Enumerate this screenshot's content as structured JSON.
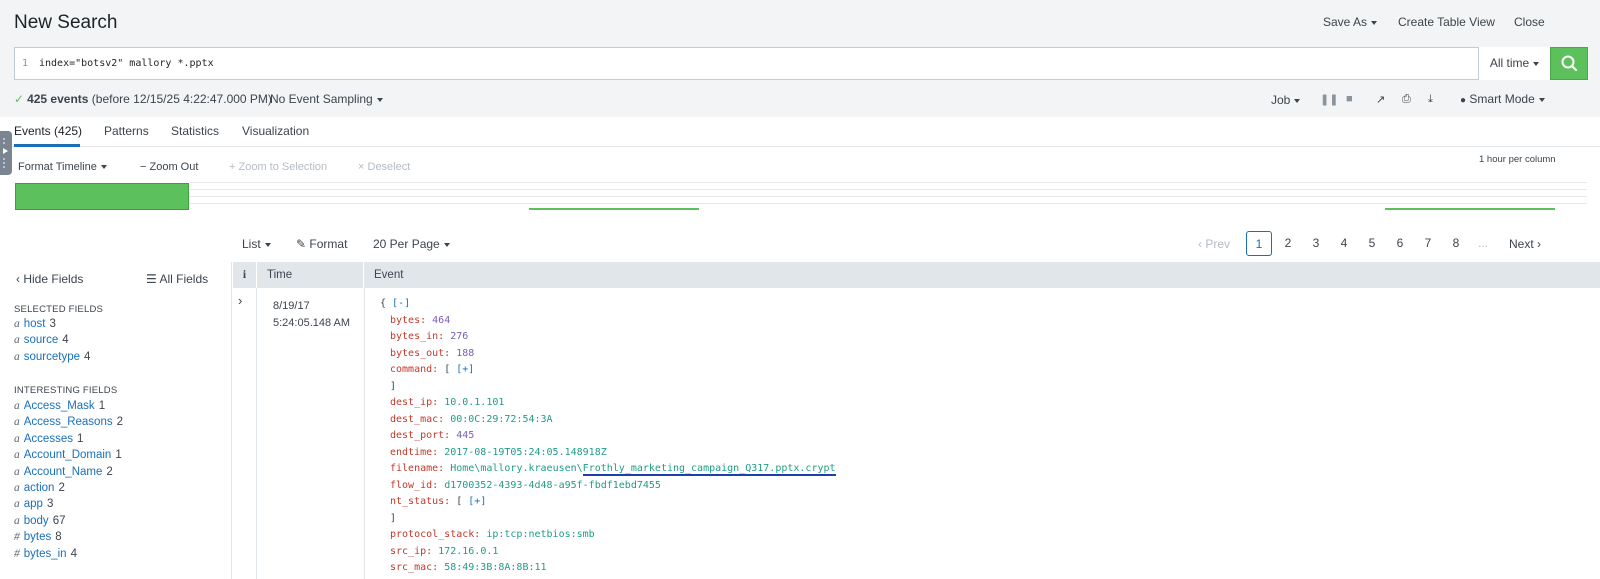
{
  "header": {
    "title": "New Search",
    "save_as": "Save As",
    "create_table_view": "Create Table View",
    "close": "Close"
  },
  "search": {
    "line_number": "1",
    "query": "index=\"botsv2\" mallory *.pptx",
    "time_range": "All time"
  },
  "status": {
    "count": "425 events",
    "detail": "(before 12/15/25 4:22:47.000 PM)",
    "sampling": "No Event Sampling",
    "job": "Job",
    "mode": "Smart Mode"
  },
  "tabs": [
    {
      "label": "Events (425)"
    },
    {
      "label": "Patterns"
    },
    {
      "label": "Statistics"
    },
    {
      "label": "Visualization"
    }
  ],
  "timeline": {
    "format": "Format Timeline",
    "zoom_out": "Zoom Out",
    "zoom_selection": "Zoom to Selection",
    "deselect": "Deselect",
    "scale": "1 hour per column"
  },
  "results_toolbar": {
    "list": "List",
    "format": "Format",
    "per_page": "20 Per Page"
  },
  "pagination": {
    "prev": "Prev",
    "pages": [
      "1",
      "2",
      "3",
      "4",
      "5",
      "6",
      "7",
      "8"
    ],
    "ellipsis": "...",
    "next": "Next"
  },
  "fields": {
    "hide": "Hide Fields",
    "all": "All Fields",
    "selected_title": "SELECTED FIELDS",
    "selected": [
      {
        "type": "a",
        "name": "host",
        "count": "3"
      },
      {
        "type": "a",
        "name": "source",
        "count": "4"
      },
      {
        "type": "a",
        "name": "sourcetype",
        "count": "4"
      }
    ],
    "interesting_title": "INTERESTING FIELDS",
    "interesting": [
      {
        "type": "a",
        "name": "Access_Mask",
        "count": "1"
      },
      {
        "type": "a",
        "name": "Access_Reasons",
        "count": "2"
      },
      {
        "type": "a",
        "name": "Accesses",
        "count": "1"
      },
      {
        "type": "a",
        "name": "Account_Domain",
        "count": "1"
      },
      {
        "type": "a",
        "name": "Account_Name",
        "count": "2"
      },
      {
        "type": "a",
        "name": "action",
        "count": "2"
      },
      {
        "type": "a",
        "name": "app",
        "count": "3"
      },
      {
        "type": "a",
        "name": "body",
        "count": "67"
      },
      {
        "type": "#",
        "name": "bytes",
        "count": "8"
      },
      {
        "type": "#",
        "name": "bytes_in",
        "count": "4"
      }
    ]
  },
  "table": {
    "col_info": "i",
    "col_time": "Time",
    "col_event": "Event"
  },
  "event": {
    "date": "8/19/17",
    "time": "5:24:05.148 AM",
    "open": "{",
    "collapse": "[-]",
    "expand": "[+]",
    "close_bracket": "]",
    "lines": [
      {
        "key": "bytes",
        "value": "464",
        "kind": "num"
      },
      {
        "key": "bytes_in",
        "value": "276",
        "kind": "num"
      },
      {
        "key": "bytes_out",
        "value": "188",
        "kind": "num"
      },
      {
        "key": "command",
        "value": "",
        "kind": "array"
      },
      {
        "key": "dest_ip",
        "value": "10.0.1.101",
        "kind": "str"
      },
      {
        "key": "dest_mac",
        "value": "00:0C:29:72:54:3A",
        "kind": "str"
      },
      {
        "key": "dest_port",
        "value": "445",
        "kind": "num"
      },
      {
        "key": "endtime",
        "value": "2017-08-19T05:24:05.148918Z",
        "kind": "str"
      },
      {
        "key": "filename",
        "value_prefix": "Home\\mallory.kraeusen\\",
        "value": "Frothly_marketing_campaign_Q317.pptx.crypt",
        "kind": "highlight"
      },
      {
        "key": "flow_id",
        "value": "d1700352-4393-4d48-a95f-fbdf1ebd7455",
        "kind": "str"
      },
      {
        "key": "nt_status",
        "value": "",
        "kind": "array"
      },
      {
        "key": "protocol_stack",
        "value": "ip:tcp:netbios:smb",
        "kind": "str"
      },
      {
        "key": "src_ip",
        "value": "172.16.0.1",
        "kind": "str"
      },
      {
        "key": "src_mac",
        "value": "58:49:3B:8A:8B:11",
        "kind": "str"
      }
    ]
  },
  "colors": {
    "accent": "#1a6fb8",
    "success": "#5cc05c",
    "json_key": "#c0392b",
    "json_string": "#1f9c8a",
    "json_number": "#7a5cb8"
  }
}
